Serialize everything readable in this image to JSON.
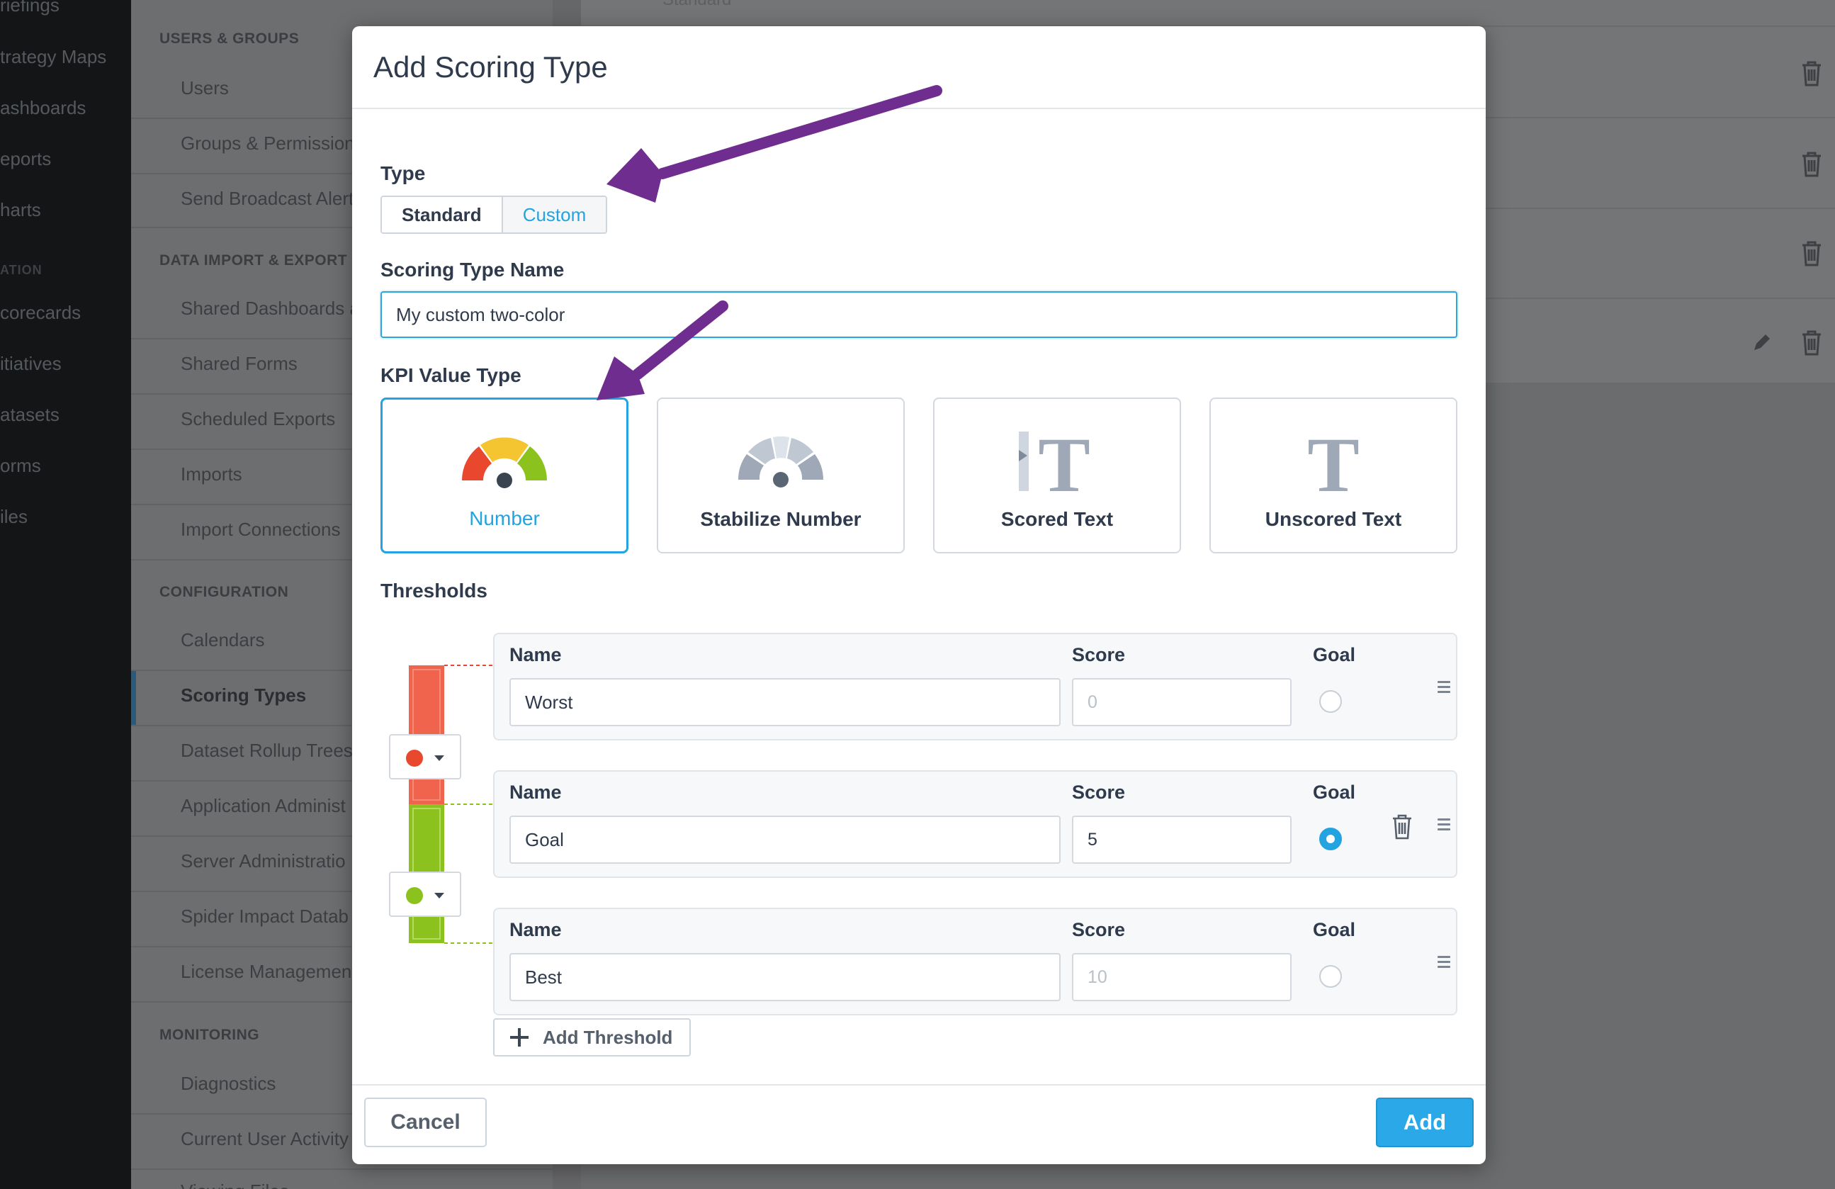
{
  "background": {
    "left_nav": [
      "riefings",
      "trategy Maps",
      "ashboards",
      "eports",
      "harts",
      "ATION",
      "corecards",
      "itiatives",
      "atasets",
      "orms",
      "iles"
    ],
    "settings": {
      "users_groups_header": "USERS & GROUPS",
      "users_groups_items": [
        "Users",
        "Groups & Permissions",
        "Send Broadcast Alert"
      ],
      "data_header": "DATA IMPORT & EXPORT",
      "data_items": [
        "Shared Dashboards a",
        "Shared Forms",
        "Scheduled Exports",
        "Imports",
        "Import Connections"
      ],
      "config_header": "CONFIGURATION",
      "config_items": [
        "Calendars",
        "Scoring Types",
        "Dataset Rollup Trees",
        "Application Administ",
        "Server Administratio",
        "Spider Impact Datab",
        "License Management"
      ],
      "monitoring_header": "MONITORING",
      "monitoring_items": [
        "Diagnostics",
        "Current User Activity",
        "Viewing Files"
      ]
    },
    "right_list_top_text": "Standard"
  },
  "modal": {
    "title": "Add Scoring Type",
    "type_label": "Type",
    "type_options": [
      "Standard",
      "Custom"
    ],
    "type_selected": "Custom",
    "name_label": "Scoring Type Name",
    "name_value": "My custom two-color",
    "kpi_label": "KPI Value Type",
    "kpi_options": [
      "Number",
      "Stabilize Number",
      "Scored Text",
      "Unscored Text"
    ],
    "kpi_selected": "Number",
    "thresholds_label": "Thresholds",
    "column_labels": {
      "name": "Name",
      "score": "Score",
      "goal": "Goal"
    },
    "thresholds": [
      {
        "name": "Worst",
        "score": "0",
        "score_is_placeholder": true,
        "goal": false,
        "color": "#e8492e"
      },
      {
        "name": "Goal",
        "score": "5",
        "score_is_placeholder": false,
        "goal": true,
        "color": "#8cc21e"
      },
      {
        "name": "Best",
        "score": "10",
        "score_is_placeholder": true,
        "goal": false
      }
    ],
    "add_threshold_label": "Add Threshold",
    "cancel_label": "Cancel",
    "add_label": "Add"
  },
  "colors": {
    "accent": "#23a3e0",
    "annotation_arrow": "#7b3a9a",
    "red_band": "#f0644d",
    "green_band": "#9ccf3a"
  }
}
